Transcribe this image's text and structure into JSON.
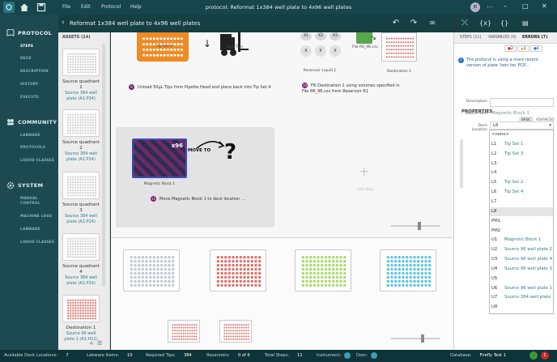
{
  "window": {
    "title": "protocol: Reformat 1x384 well plate to 4x96 well plates",
    "menu": [
      "File",
      "Edit",
      "Protocol",
      "Help"
    ],
    "user_initials": "JB",
    "more": "...",
    "min": "–",
    "max": "□",
    "close": "✕",
    "scroll_label": "▾"
  },
  "sidebar": {
    "protocol_label": "PROTOCOL",
    "protocol_items": [
      "STEPS",
      "DECK",
      "DESCRIPTION",
      "HISTORY",
      "EXECUTE"
    ],
    "community_label": "COMMUNITY",
    "community_items": [
      "LABWARE",
      "PROTOCOLS",
      "LIQUID CLASSES"
    ],
    "system_label": "SYSTEM",
    "system_items": [
      "MANUAL CONTROL",
      "MACHINE LOGS",
      "LABWARE",
      "LIQUID CLASSES"
    ]
  },
  "header": {
    "title": "Reformat 1x384 well plate to 4x96 well plates"
  },
  "assets": {
    "header": "ASSETS (14)",
    "items": [
      {
        "name": "Source quadrant 1",
        "sub": "Source 384 well plate (A1:P24)"
      },
      {
        "name": "Source quadrant 2",
        "sub": "Source 384 well plate (A1:P24)"
      },
      {
        "name": "Source quadrant 3",
        "sub": "Source 384 well plate (A1:P24)"
      },
      {
        "name": "Source quadrant 4",
        "sub": "Source 384 well plate (A1:P24)"
      },
      {
        "name": "Destination 1",
        "sub": "Source 96 well plate 1 (A1:H12)"
      }
    ]
  },
  "steps": {
    "tipset_label": "Tip Set 4",
    "tips_label": "50μL Tips",
    "reservoir_label": "Reservoir Liquid 1",
    "file_label": "File R6_96.csv",
    "destination_label": "Destination 1",
    "step9_num": "9",
    "step9_text": "Unload 50μL Tips from Pipette Head and place back into Tip Set 4",
    "step10_num": "10",
    "step10_text": "Fill Destination 1 using volumes specified in File R6_96.csv from Reservoir R1",
    "magnetic_label": "Magnetic Block 1",
    "magnetic_badge": "x96",
    "move_label": "MOVE TO",
    "question": "?",
    "step11_num": "11",
    "step11_text": "Move Magnetic Block 1 to deck location ...",
    "add_step_label": "Add Step",
    "slot_labels": [
      "X1",
      "X2",
      "X3"
    ],
    "x_label": "X"
  },
  "right_panel": {
    "tabs": [
      "STEPS (11)",
      "VARIABLES (0)",
      "ERRORS (7)"
    ],
    "error_counts": [
      "2",
      "1",
      "4"
    ],
    "info_text": "The protocol is using a more recent version of plate 'twin.tec PCR...",
    "properties_label": "PROPERTIES",
    "prop_tabs": [
      "BASIC",
      "ADVANCED"
    ],
    "description_label": "Description",
    "source_item_label": "Source Item",
    "source_item_value": "Magnetic Block 1",
    "deck_location_label": "Deck Location",
    "deck_location_value": "L8",
    "dropdown": [
      {
        "k": "<none>",
        "v": ""
      },
      {
        "k": "L1",
        "v": "Tip Set 1"
      },
      {
        "k": "L2",
        "v": "Tip Set 3"
      },
      {
        "k": "L3",
        "v": ""
      },
      {
        "k": "L4",
        "v": ""
      },
      {
        "k": "L5",
        "v": "Tip Set 2"
      },
      {
        "k": "L6",
        "v": "Tip Set 4"
      },
      {
        "k": "L7",
        "v": ""
      },
      {
        "k": "L8",
        "v": ""
      },
      {
        "k": "PM1",
        "v": ""
      },
      {
        "k": "PM2",
        "v": ""
      },
      {
        "k": "U1",
        "v": "Magnetic Block 1"
      },
      {
        "k": "U2",
        "v": "Source 96 well plate 2"
      },
      {
        "k": "U3",
        "v": "Source 96 well plate 4"
      },
      {
        "k": "U4",
        "v": "Source 96 well plate 3"
      },
      {
        "k": "U5",
        "v": ""
      },
      {
        "k": "U6",
        "v": "Source 96 well plate 1"
      },
      {
        "k": "U7",
        "v": "Source 384 well plate"
      },
      {
        "k": "U8",
        "v": ""
      }
    ]
  },
  "status": {
    "deck_locations_label": "Available Deck Locations:",
    "deck_locations_value": "7",
    "labware_label": "Labware Items:",
    "labware_value": "10",
    "tips_label": "Required Tips:",
    "tips_value": "384",
    "reservoirs_label": "Reservoirs:",
    "reservoirs_value": "0 of 6",
    "total_steps_label": "Total Steps:",
    "total_steps_value": "11",
    "instrument_label": "Instrument:",
    "door_label": "Door:",
    "database_label": "Database:",
    "database_value": "Firefly Test 1",
    "notif_count": "1"
  },
  "colors": {
    "accent": "#2a7f8a",
    "step_badge": "#7c1f6a",
    "tip_orange": "#f08a24",
    "well_red": "#e0706a",
    "well_green": "#a8d96b",
    "well_blue": "#5cc4e6"
  }
}
